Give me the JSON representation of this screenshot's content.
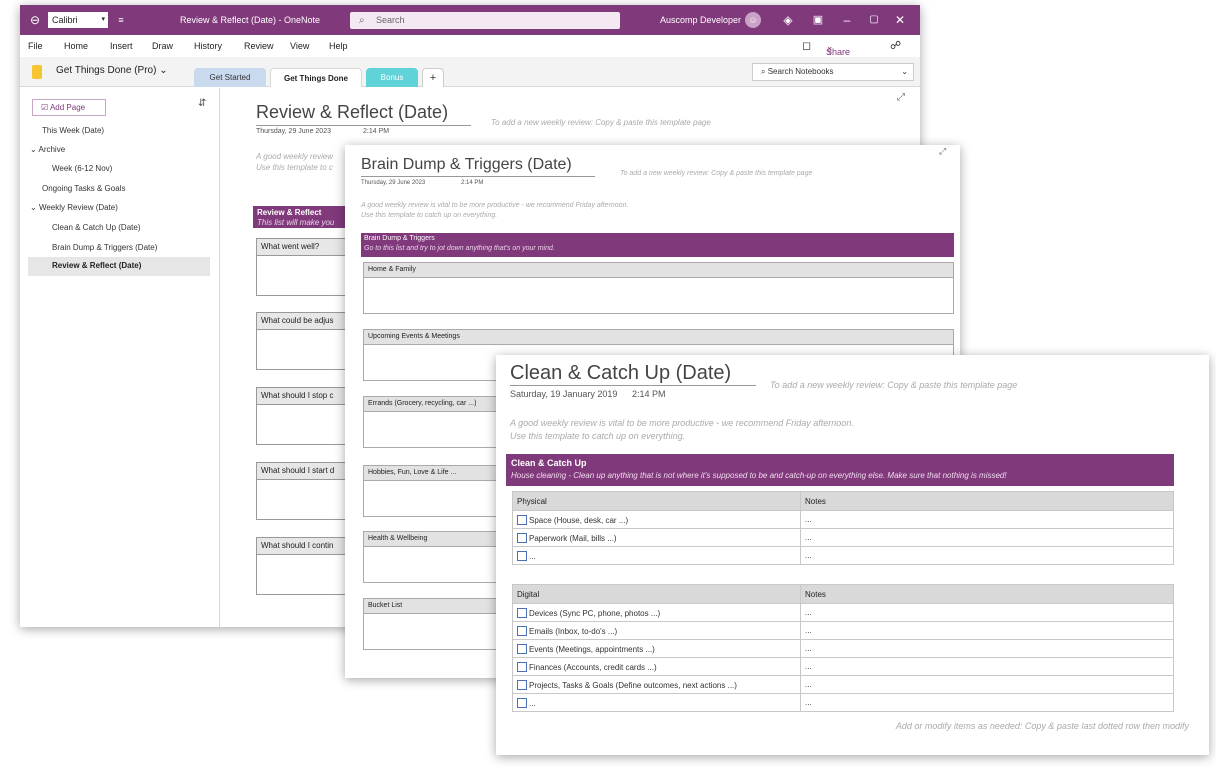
{
  "app": {
    "font_name": "Calibri",
    "window_title": "Review & Reflect (Date)  -  OneNote",
    "search_placeholder": "Search",
    "user_name": "Auscomp Developer",
    "accent_color": "#80397b"
  },
  "menu": [
    "File",
    "Home",
    "Insert",
    "Draw",
    "History",
    "Review",
    "View",
    "Help"
  ],
  "share_label": "Share",
  "notebook": {
    "name": "Get Things Done (Pro)",
    "tabs": [
      {
        "label": "Get Started",
        "color": "#c9d9ee"
      },
      {
        "label": "Get Things Done",
        "color": "#ffffff"
      },
      {
        "label": "Bonus",
        "color": "#5fd3d8"
      }
    ],
    "add_tab": "+",
    "search_notebooks": "Search Notebooks"
  },
  "sidebar": {
    "add_page": "Add Page",
    "pages": [
      {
        "label": "This Week (Date)"
      },
      {
        "label": "Archive",
        "expand": "⌄"
      },
      {
        "label": "Week (6-12 Nov)"
      },
      {
        "label": "Ongoing Tasks & Goals"
      },
      {
        "label": "Weekly Review (Date)",
        "expand": "⌄"
      },
      {
        "label": "Clean & Catch Up (Date)"
      },
      {
        "label": "Brain Dump & Triggers (Date)"
      },
      {
        "label": "Review & Reflect (Date)"
      }
    ]
  },
  "page1": {
    "title": "Review & Reflect (Date)",
    "date": "Thursday, 29 June 2023",
    "time": "2:14 PM",
    "hint": "To add a new weekly review: Copy & paste this template page",
    "intro1": "A good weekly review",
    "intro2": "Use this template to c",
    "banner_title": "Review & Reflect",
    "banner_sub": "This list will make you",
    "questions": [
      "What went well?",
      "What could be adjus",
      "What should I stop c",
      "What should I start d",
      "What should I contin"
    ]
  },
  "page2": {
    "title": "Brain Dump & Triggers (Date)",
    "date": "Thursday, 29 June 2023",
    "time": "2:14 PM",
    "hint": "To add a new weekly review: Copy & paste this template page",
    "intro1": "A good weekly review is vital to be more productive - we recommend Friday afternoon.",
    "intro2": "Use this template to catch up on everything.",
    "banner_title": "Brain Dump & Triggers",
    "banner_sub": "Go to this list and try to jot down anything that's on your mind.",
    "sections": [
      "Home & Family",
      "Upcoming Events & Meetings",
      "Errands (Grocery, recycling, car ...)",
      "Hobbies, Fun, Love & Life ...",
      "Health & Wellbeing",
      "Bucket List"
    ]
  },
  "page3": {
    "title": "Clean & Catch Up (Date)",
    "date": "Saturday, 19 January 2019",
    "time": "2:14 PM",
    "hint": "To add a new weekly review: Copy & paste this template page",
    "intro1": "A good weekly review is vital to be more productive - we recommend Friday afternoon.",
    "intro2": "Use this template to catch up on everything.",
    "banner_title": "Clean & Catch Up",
    "banner_sub": "House cleaning - Clean up anything that is not where it's supposed to be and catch-up on everything else. Make sure that nothing is missed!",
    "physical": {
      "header": "Physical",
      "notes_header": "Notes",
      "rows": [
        {
          "item": "Space (House, desk, car ...)",
          "notes": "..."
        },
        {
          "item": "Paperwork (Mail, bills ...)",
          "notes": "..."
        },
        {
          "item": "...",
          "notes": "..."
        }
      ]
    },
    "digital": {
      "header": "Digital",
      "notes_header": "Notes",
      "rows": [
        {
          "item": "Devices (Sync PC, phone, photos ...)",
          "notes": "..."
        },
        {
          "item": "Emails (Inbox, to-do's ...)",
          "notes": "..."
        },
        {
          "item": "Events (Meetings, appointments ...)",
          "notes": "..."
        },
        {
          "item": "Finances (Accounts, credit cards ...)",
          "notes": "..."
        },
        {
          "item": "Projects, Tasks & Goals (Define outcomes, next actions ...)",
          "notes": "..."
        },
        {
          "item": "...",
          "notes": "..."
        }
      ]
    },
    "footer": "Add or modify items as needed: Copy & paste last dotted row then modify"
  }
}
